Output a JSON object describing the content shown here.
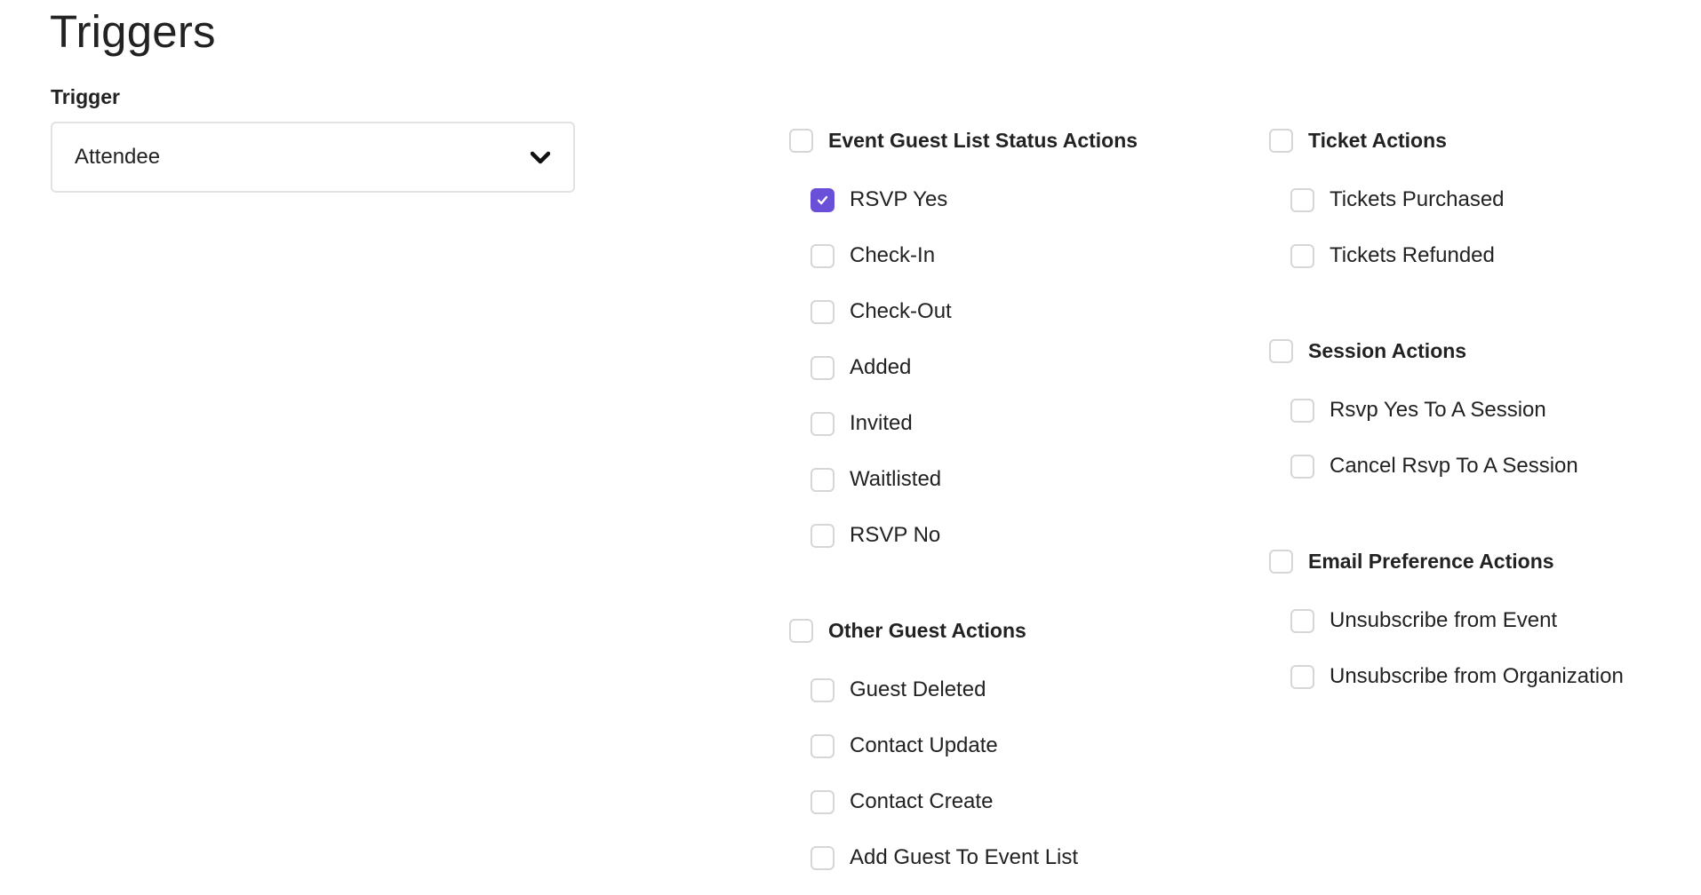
{
  "page": {
    "title": "Triggers"
  },
  "trigger": {
    "label": "Trigger",
    "selected": "Attendee",
    "icon": "chevron-down-icon"
  },
  "colors": {
    "accent": "#6a4fd9",
    "text": "#222222",
    "border": "#d6d6d6"
  },
  "groups": {
    "event_guest_list_status": {
      "title": "Event Guest List Status Actions",
      "checked": false,
      "items": [
        {
          "label": "RSVP Yes",
          "checked": true
        },
        {
          "label": "Check-In",
          "checked": false
        },
        {
          "label": "Check-Out",
          "checked": false
        },
        {
          "label": "Added",
          "checked": false
        },
        {
          "label": "Invited",
          "checked": false
        },
        {
          "label": "Waitlisted",
          "checked": false
        },
        {
          "label": "RSVP No",
          "checked": false
        }
      ]
    },
    "other_guest": {
      "title": "Other Guest Actions",
      "checked": false,
      "items": [
        {
          "label": "Guest Deleted",
          "checked": false
        },
        {
          "label": "Contact Update",
          "checked": false
        },
        {
          "label": "Contact Create",
          "checked": false
        },
        {
          "label": "Add Guest To Event List",
          "checked": false
        }
      ]
    },
    "ticket": {
      "title": "Ticket Actions",
      "checked": false,
      "items": [
        {
          "label": "Tickets Purchased",
          "checked": false
        },
        {
          "label": "Tickets Refunded",
          "checked": false
        }
      ]
    },
    "session": {
      "title": "Session Actions",
      "checked": false,
      "items": [
        {
          "label": "Rsvp Yes To A Session",
          "checked": false
        },
        {
          "label": "Cancel Rsvp To A Session",
          "checked": false
        }
      ]
    },
    "email_preference": {
      "title": "Email Preference Actions",
      "checked": false,
      "items": [
        {
          "label": "Unsubscribe from Event",
          "checked": false
        },
        {
          "label": "Unsubscribe from Organization",
          "checked": false
        }
      ]
    }
  }
}
